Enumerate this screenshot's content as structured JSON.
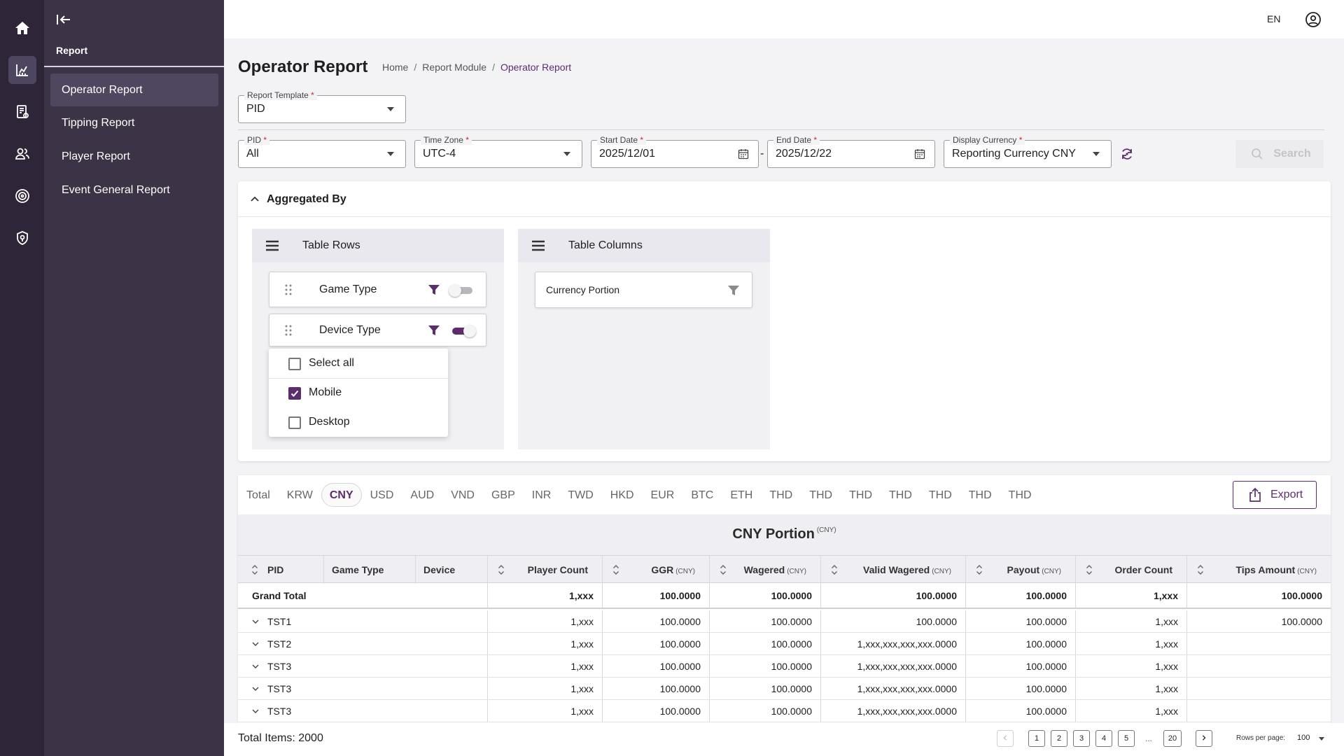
{
  "sidebar": {
    "section": "Report",
    "items": [
      {
        "label": "Operator Report"
      },
      {
        "label": "Tipping Report"
      },
      {
        "label": "Player Report"
      },
      {
        "label": "Event General Report"
      }
    ]
  },
  "topbar": {
    "language": "EN"
  },
  "page": {
    "title": "Operator Report",
    "breadcrumb": [
      "Home",
      "Report Module",
      "Operator Report"
    ]
  },
  "filters": {
    "report_template": {
      "label": "Report Template",
      "value": "PID"
    },
    "pid": {
      "label": "PID",
      "value": "All"
    },
    "time_zone": {
      "label": "Time Zone",
      "value": "UTC-4"
    },
    "start_date": {
      "label": "Start Date",
      "value": "2025/12/01"
    },
    "end_date": {
      "label": "End Date",
      "value": "2025/12/22"
    },
    "display_currency": {
      "label": "Display Currency",
      "value": "Reporting Currency CNY"
    },
    "required_mark": "*",
    "date_separator": "-",
    "search_label": "Search"
  },
  "aggregated": {
    "title": "Aggregated By",
    "rows_panel": "Table Rows",
    "columns_panel": "Table Columns",
    "row_items": [
      {
        "label": "Game Type",
        "enabled": false
      },
      {
        "label": "Device Type",
        "enabled": true
      }
    ],
    "column_items": [
      {
        "label": "Currency Portion"
      }
    ],
    "device_dropdown": [
      {
        "label": "Select all",
        "checked": false
      },
      {
        "label": "Mobile",
        "checked": true
      },
      {
        "label": "Desktop",
        "checked": false
      }
    ]
  },
  "currency_tabs": [
    "Total",
    "KRW",
    "CNY",
    "USD",
    "AUD",
    "VND",
    "GBP",
    "INR",
    "TWD",
    "HKD",
    "EUR",
    "BTC",
    "ETH",
    "THD",
    "THD",
    "THD",
    "THD",
    "THD",
    "THD",
    "THD"
  ],
  "active_tab": "CNY",
  "export_label": "Export",
  "table": {
    "title": "CNY Portion",
    "title_unit": "(CNY)",
    "columns": [
      {
        "label": "PID",
        "unit": ""
      },
      {
        "label": "Game Type",
        "unit": ""
      },
      {
        "label": "Device",
        "unit": ""
      },
      {
        "label": "Player Count",
        "unit": ""
      },
      {
        "label": "GGR",
        "unit": "(CNY)"
      },
      {
        "label": "Wagered",
        "unit": "(CNY)"
      },
      {
        "label": "Valid Wagered",
        "unit": "(CNY)"
      },
      {
        "label": "Payout",
        "unit": "(CNY)"
      },
      {
        "label": "Order Count",
        "unit": ""
      },
      {
        "label": "Tips Amount",
        "unit": "(CNY)"
      }
    ],
    "grand_total": {
      "label": "Grand Total",
      "player_count": "1,xxx",
      "ggr": "100.0000",
      "wagered": "100.0000",
      "valid_wagered": "100.0000",
      "payout": "100.0000",
      "order_count": "1,xxx",
      "tips": "100.0000"
    },
    "rows": [
      {
        "pid": "TST1",
        "player_count": "1,xxx",
        "ggr": "100.0000",
        "wagered": "100.0000",
        "valid_wagered": "100.0000",
        "payout": "100.0000",
        "order_count": "1,xxx",
        "tips": "100.0000"
      },
      {
        "pid": "TST2",
        "player_count": "1,xxx",
        "ggr": "100.0000",
        "wagered": "100.0000",
        "valid_wagered": "1,xxx,xxx,xxx,xxx.0000",
        "payout": "100.0000",
        "order_count": "1,xxx",
        "tips": ""
      },
      {
        "pid": "TST3",
        "player_count": "1,xxx",
        "ggr": "100.0000",
        "wagered": "100.0000",
        "valid_wagered": "1,xxx,xxx,xxx,xxx.0000",
        "payout": "100.0000",
        "order_count": "1,xxx",
        "tips": ""
      },
      {
        "pid": "TST3",
        "player_count": "1,xxx",
        "ggr": "100.0000",
        "wagered": "100.0000",
        "valid_wagered": "1,xxx,xxx,xxx,xxx.0000",
        "payout": "100.0000",
        "order_count": "1,xxx",
        "tips": ""
      },
      {
        "pid": "TST3",
        "player_count": "1,xxx",
        "ggr": "100.0000",
        "wagered": "100.0000",
        "valid_wagered": "1,xxx,xxx,xxx,xxx.0000",
        "payout": "100.0000",
        "order_count": "1,xxx",
        "tips": ""
      }
    ]
  },
  "pagination": {
    "total_label": "Total Items: 2000",
    "pages": [
      "1",
      "2",
      "3",
      "4",
      "5"
    ],
    "ellipsis": "...",
    "last_page": "20",
    "rows_per_page_label": "Rows per page:",
    "rows_per_page": "100"
  },
  "colors": {
    "brand": "#5c2d6e",
    "sidebar": "#3c3347",
    "rail": "#2e2638"
  },
  "icons": [
    "home-icon",
    "analytics-icon",
    "report-doc-icon",
    "users-icon",
    "target-icon",
    "shield-icon",
    "collapse-icon",
    "user-account-icon",
    "calendar-icon",
    "refresh-icon",
    "search-icon",
    "filter-icon",
    "drag-handle-icon",
    "menu-icon",
    "export-icon",
    "chevron-down-icon",
    "chevron-up-icon",
    "sort-icon"
  ]
}
